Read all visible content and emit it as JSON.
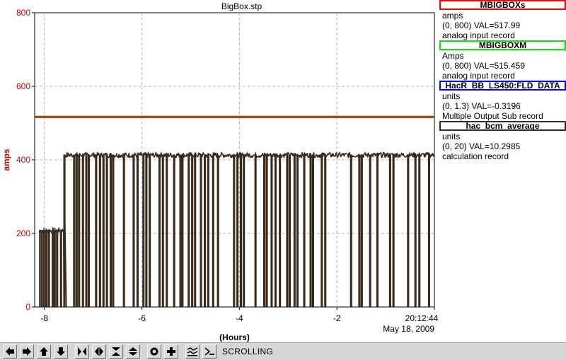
{
  "chart_data": {
    "type": "line",
    "title": "BigBox.stp",
    "xlabel": "(Hours)",
    "ylabel": "amps",
    "xlim": [
      -8.2,
      0
    ],
    "ylim": [
      0,
      800
    ],
    "x_ticks": [
      -8,
      -6,
      -4,
      -2
    ],
    "x_tick_labels": [
      "-8",
      "-6",
      "-4",
      "-2"
    ],
    "y_ticks": [
      0,
      200,
      400,
      600,
      800
    ],
    "y_tick_labels": [
      "0",
      "200",
      "400",
      "600",
      "800"
    ],
    "end_time": "20:12:44",
    "end_date": "May 18, 2009",
    "grid": true,
    "series": [
      {
        "name": "MBIGBOXs",
        "color": "#ff0000",
        "values_constant": 517.99,
        "x": [
          -8.2,
          0
        ],
        "y": [
          517.99,
          517.99
        ]
      },
      {
        "name": "MBIGBOXM",
        "color": "#00ee00",
        "values_constant": 515.459,
        "x": [
          -8.2,
          0
        ],
        "y": [
          515.459,
          515.459
        ]
      },
      {
        "name": "HacR_BB_LS450:FLD_DATA",
        "color": "#0000ff",
        "x": [],
        "y": []
      },
      {
        "name": "hac_bcm_average",
        "color": "#3a2a1c",
        "baseline_segments": [
          {
            "x": [
              -8.1,
              -7.6
            ],
            "y": 208
          },
          {
            "x": [
              -7.55,
              0
            ],
            "y": 413
          }
        ],
        "trips_to_zero_x": [
          -8.07,
          -8.02,
          -7.97,
          -7.92,
          -7.84,
          -7.8,
          -7.75,
          -7.67,
          -7.6,
          -7.4,
          -7.35,
          -7.3,
          -7.22,
          -7.15,
          -7.1,
          -6.95,
          -6.87,
          -6.8,
          -6.73,
          -6.65,
          -6.6,
          -6.38,
          -6.18,
          -6.1,
          -5.98,
          -5.92,
          -5.85,
          -5.65,
          -5.58,
          -5.5,
          -5.35,
          -5.22,
          -5.18,
          -5.05,
          -4.98,
          -4.92,
          -4.8,
          -4.72,
          -4.65,
          -4.55,
          -4.45,
          -4.12,
          -4.05,
          -3.98,
          -3.92,
          -3.68,
          -3.5,
          -3.45,
          -3.35,
          -3.27,
          -3.18,
          -3.03,
          -2.98,
          -2.88,
          -2.82,
          -2.68,
          -2.55,
          -2.5,
          -2.32,
          -2.25,
          -1.72,
          -1.55,
          -1.5,
          -1.33,
          -1.18,
          -0.92,
          -0.85,
          -0.55,
          -0.4,
          -0.32,
          -0.12
        ]
      }
    ]
  },
  "legend": [
    {
      "name": "MBIGBOXs",
      "border_color": "#ff0000",
      "units": "amps",
      "range_val": "(0, 800)  VAL=517.99",
      "record": "analog input record"
    },
    {
      "name": "MBIGBOXM",
      "border_color": "#00ee00",
      "units": "Amps",
      "range_val": "(0, 800)  VAL=515.459",
      "record": "analog input record"
    },
    {
      "name": "HacR_BB_LS450:FLD_DATA",
      "border_color": "#0000ff",
      "units": "units",
      "range_val": "(0, 1.3)  VAL=-0.3196",
      "record": "Multiple Output Sub record"
    },
    {
      "name": "hac_bcm_average",
      "border_color": "#3a2a1c",
      "units": "units",
      "range_val": "(0, 20)  VAL=10.2985",
      "record": "calculation record"
    }
  ],
  "colors": {
    "axis_label": "#cc0000",
    "tick_label": "#cc0000",
    "grid": "#b4b4b4",
    "flat_trace": "#a0521a",
    "toolbar_bg": "#d6d6d6"
  },
  "toolbar": {
    "status": "SCROLLING",
    "buttons": [
      {
        "name": "scroll-left-icon"
      },
      {
        "name": "scroll-right-icon"
      },
      {
        "name": "scroll-up-icon"
      },
      {
        "name": "scroll-down-icon"
      },
      {
        "name": "zoom-in-x-icon"
      },
      {
        "name": "zoom-out-x-icon"
      },
      {
        "name": "zoom-in-y-icon"
      },
      {
        "name": "zoom-out-y-icon"
      },
      {
        "name": "autoscale-icon"
      },
      {
        "name": "plus-icon"
      },
      {
        "name": "scroll-mode-icon"
      },
      {
        "name": "zoom-mode-icon"
      }
    ]
  }
}
